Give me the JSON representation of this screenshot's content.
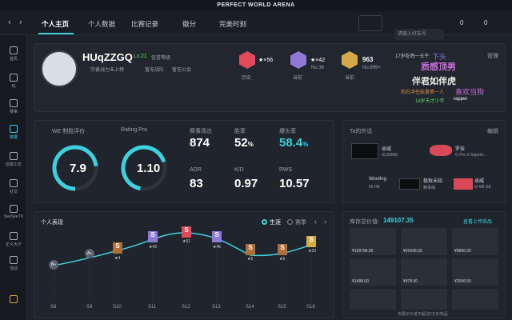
{
  "app_title": "PERFECT WORLD ARENA",
  "tabs": [
    "个人主页",
    "个人数据",
    "比赛记录",
    "徽分",
    "完美时刻"
  ],
  "search": {
    "placeholder": "请输入好友号"
  },
  "coins": "0",
  "points": "0",
  "sidebar": [
    "首页",
    "玩",
    "赛事",
    "数据",
    "创意工坊",
    "社交",
    "SeeSeeTV",
    "正义大厅",
    "活动"
  ],
  "profile": {
    "name": "HUqZZGQ",
    "level": "Lv.21",
    "tag": "信誉等级",
    "line1": "完善战力未上榜",
    "line2": "暂无战队",
    "line3": "暂无公会"
  },
  "ranks": [
    {
      "label": "历史",
      "stars": "★×56"
    },
    {
      "label": "当前",
      "stars": "★×42",
      "sub": "No.36"
    },
    {
      "label": "当前",
      "stars": "963",
      "sub": "No.999+"
    }
  ],
  "manage": "管理",
  "tags": [
    "17岁吃鸡一头牛",
    "下头",
    "质感顶男",
    "伴君如伴虎",
    "粘石冲任能量第一人",
    "喜欢当狗",
    "18岁天才少年",
    "rapper"
  ],
  "ratings": [
    {
      "title": "WE 制胜评价",
      "value": "7.9"
    },
    {
      "title": "Rating Pro",
      "value": "1.10"
    }
  ],
  "stats": [
    {
      "title": "赛事场次",
      "value": "874"
    },
    {
      "title": "胜率",
      "value": "52",
      "unit": "%"
    },
    {
      "title": "爆头率",
      "value": "58.4",
      "unit": "%"
    },
    {
      "title": "ADR",
      "value": "83"
    },
    {
      "title": "K/D",
      "value": "0.97"
    },
    {
      "title": "RWS",
      "value": "10.57"
    }
  ],
  "ta_title": "Ta的外设",
  "ta_edit": "编辑",
  "peripherals": [
    {
      "name": "卓威",
      "model": "XL2566K"
    },
    {
      "name": "罗技",
      "model": "G Pro X Superli..."
    },
    {
      "name": "Wooting",
      "model": "60 HE"
    },
    {
      "name": "极致未知",
      "model": "赌毒绳"
    },
    {
      "name": "卓威",
      "model": "G-SR-SE"
    }
  ],
  "perf": {
    "title": "个人表现",
    "toggle1": "生涯",
    "toggle2": "赛季",
    "seasons": [
      "S8",
      "S9",
      "S10",
      "S11",
      "S12",
      "S13",
      "S14",
      "S15",
      "S16"
    ],
    "points": [
      {
        "rank": "B+",
        "stars": ""
      },
      {
        "rank": "A+",
        "stars": ""
      },
      {
        "rank": "S",
        "stars": "★4"
      },
      {
        "rank": "S",
        "stars": "★43"
      },
      {
        "rank": "S",
        "stars": "★51"
      },
      {
        "rank": "S",
        "stars": "★46"
      },
      {
        "rank": "S",
        "stars": "★5"
      },
      {
        "rank": "S",
        "stars": "★6"
      },
      {
        "rank": "S",
        "stars": "★23"
      }
    ]
  },
  "inventory": {
    "label": "库存总价值:",
    "value": "149107.35",
    "link": "查看上传饰品",
    "items": [
      "¥108798.99",
      "¥25698.00",
      "¥8866.00",
      "¥1488.00",
      "¥978.00",
      "¥2506.50",
      "",
      "",
      ""
    ],
    "footer": "仅展示价值不超过5万的饰品"
  }
}
